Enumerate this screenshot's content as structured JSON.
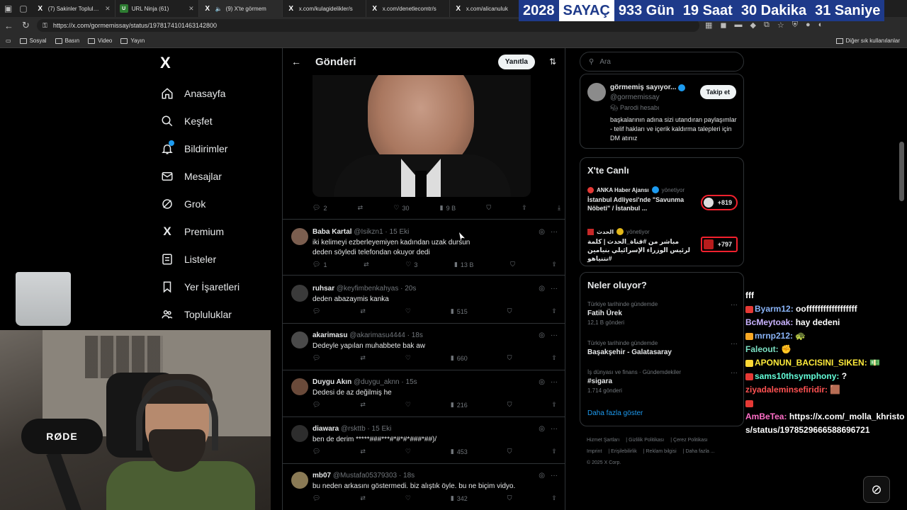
{
  "browser": {
    "tabs": [
      {
        "title": "(7) Sakinler Topluluk /",
        "icon": "x-icon"
      },
      {
        "title": "URL Ninja (61)",
        "icon": "url-ninja-icon"
      },
      {
        "title": "(9) X'te görmem",
        "icon": "x-icon",
        "active": true
      },
      {
        "title": "x.com/kulagidelikler/s",
        "icon": "x-icon"
      },
      {
        "title": "x.com/denetlecomtr/s",
        "icon": "x-icon"
      },
      {
        "title": "x.com/alicanuluk",
        "icon": "x-icon"
      }
    ],
    "url": "https://x.com/gormemissay/status/1978174101463142800",
    "bookmarks": [
      "Sosyal",
      "Basın",
      "Video",
      "Yayın"
    ],
    "bookmarks_right": "Diğer sık kullanılanlar"
  },
  "counter": {
    "year": "2028",
    "label": "SAYAÇ",
    "days": "933 Gün",
    "hours": "19 Saat",
    "minutes": "30 Dakika",
    "seconds": "31 Saniye"
  },
  "nav": {
    "logo": "X",
    "items": [
      {
        "label": "Anasayfa",
        "icon": "home-icon"
      },
      {
        "label": "Keşfet",
        "icon": "search-icon"
      },
      {
        "label": "Bildirimler",
        "icon": "bell-icon"
      },
      {
        "label": "Mesajlar",
        "icon": "mail-icon"
      },
      {
        "label": "Grok",
        "icon": "grok-icon"
      },
      {
        "label": "Premium",
        "icon": "x-premium-icon"
      },
      {
        "label": "Listeler",
        "icon": "list-icon"
      },
      {
        "label": "Yer İşaretleri",
        "icon": "bookmark-icon"
      },
      {
        "label": "Topluluklar",
        "icon": "communities-icon"
      }
    ]
  },
  "post": {
    "header_title": "Gönderi",
    "reply_button": "Yanıtla",
    "stats": {
      "replies": "2",
      "likes": "30",
      "views": "9 B"
    }
  },
  "replies": [
    {
      "name": "Baba Kartal",
      "handle": "@Isikzn1",
      "time": "15 Eki",
      "text": "iki kelimeyi ezberleyemiyen kadından uzak dursun deden söyledi telefondan okuyor dedi",
      "replies": "1",
      "likes": "3",
      "views": "13 B"
    },
    {
      "name": "ruhsar",
      "handle": "@keyfimbenkahyas",
      "time": "20s",
      "text": "deden abazaymis kanka",
      "replies": "",
      "likes": "",
      "views": "515"
    },
    {
      "name": "akarimasu",
      "handle": "@akarimasu4444",
      "time": "18s",
      "text": "Dedeyle yapılan muhabbete bak aw",
      "replies": "",
      "likes": "",
      "views": "660"
    },
    {
      "name": "Duygu Akın",
      "handle": "@duygu_aknn",
      "time": "15s",
      "text": "Dedesi de az değilmiş he",
      "replies": "",
      "likes": "",
      "views": "216"
    },
    {
      "name": "diawara",
      "handle": "@rskttb",
      "time": "15 Eki",
      "text": "ben de derim *****###***#*#*#*###*##)/",
      "replies": "",
      "likes": "",
      "views": "453"
    },
    {
      "name": "mb07",
      "handle": "@Mustafa05379303",
      "time": "18s",
      "text": "bu neden arkasını göstermedi. biz alıştık öyle. bu ne biçim vidyo.",
      "replies": "",
      "likes": "",
      "views": "342"
    }
  ],
  "right": {
    "search_placeholder": "Ara",
    "profile": {
      "name": "görmemiş sayıyor...",
      "handle": "@gormemissay",
      "follow": "Takip et",
      "parody": "Parodi hesabı",
      "bio": "başkalarının adına sizi utandıran paylaşımlar - telif hakları ve içerik kaldırma talepleri için DM atınız"
    },
    "live": {
      "title": "X'te Canlı",
      "items": [
        {
          "source": "ANKA Haber Ajansı",
          "status": "yönetiyor",
          "title": "İstanbul Adliyesi'nde \"Savunma Nöbeti\" / İstanbul ...",
          "count": "+819"
        },
        {
          "source": "الحدث",
          "status": "yönetiyor",
          "title": "مباشر من #قناة_الحدث | كلمة لرئيس الوزراء الإسرائيلي بنيامين #نتنياهو",
          "count": "+797"
        }
      ]
    },
    "trends": {
      "title": "Neler oluyor?",
      "items": [
        {
          "context": "Türkiye tarihinde gündemde",
          "name": "Fatih Ürek",
          "count": "12,1 B gönderi"
        },
        {
          "context": "Türkiye tarihinde gündemde",
          "name": "Başakşehir - Galatasaray",
          "count": ""
        },
        {
          "context": "İş dünyası ve finans · Gündemdekiler",
          "name": "#sigara",
          "count": "1.714 gönderi"
        }
      ],
      "show_more": "Daha fazla göster"
    },
    "footer": [
      "Hizmet Şartları",
      "Gizlilik Politikası",
      "Çerez Politikası",
      "Imprint",
      "Erişilebilirlik",
      "Reklam bilgisi",
      "Daha fazla ...",
      "© 2025 X Corp."
    ]
  },
  "webcam": {
    "mic_brand": "RØDE"
  },
  "chat": [
    {
      "user": "",
      "msg": "fff",
      "color": "#ffffff"
    },
    {
      "user": "Byarm12:",
      "msg": "ooffffffffffffffffff",
      "color": "#8ab4f8"
    },
    {
      "user": "BcMeytoak:",
      "msg": "hay dedeni",
      "color": "#c9b3ff"
    },
    {
      "user": "mrnp212:",
      "msg": "🐢",
      "color": "#8ab4f8"
    },
    {
      "user": "Faleout:",
      "msg": "✊",
      "color": "#7be0c3"
    },
    {
      "user": "APONUN_BACISINI_SIKEN:",
      "msg": "💵",
      "color": "#ffeb3b"
    },
    {
      "user": "sams10thsymphony:",
      "msg": "?",
      "color": "#64ffda"
    },
    {
      "user": "ziyadaleminsefiridir:",
      "msg": "🟫",
      "color": "#ff5252"
    },
    {
      "user": "AmBeTea:",
      "msg": "https://x.com/_molla_khristos/status/1978529666588696721",
      "color": "#ff6ec7"
    }
  ]
}
